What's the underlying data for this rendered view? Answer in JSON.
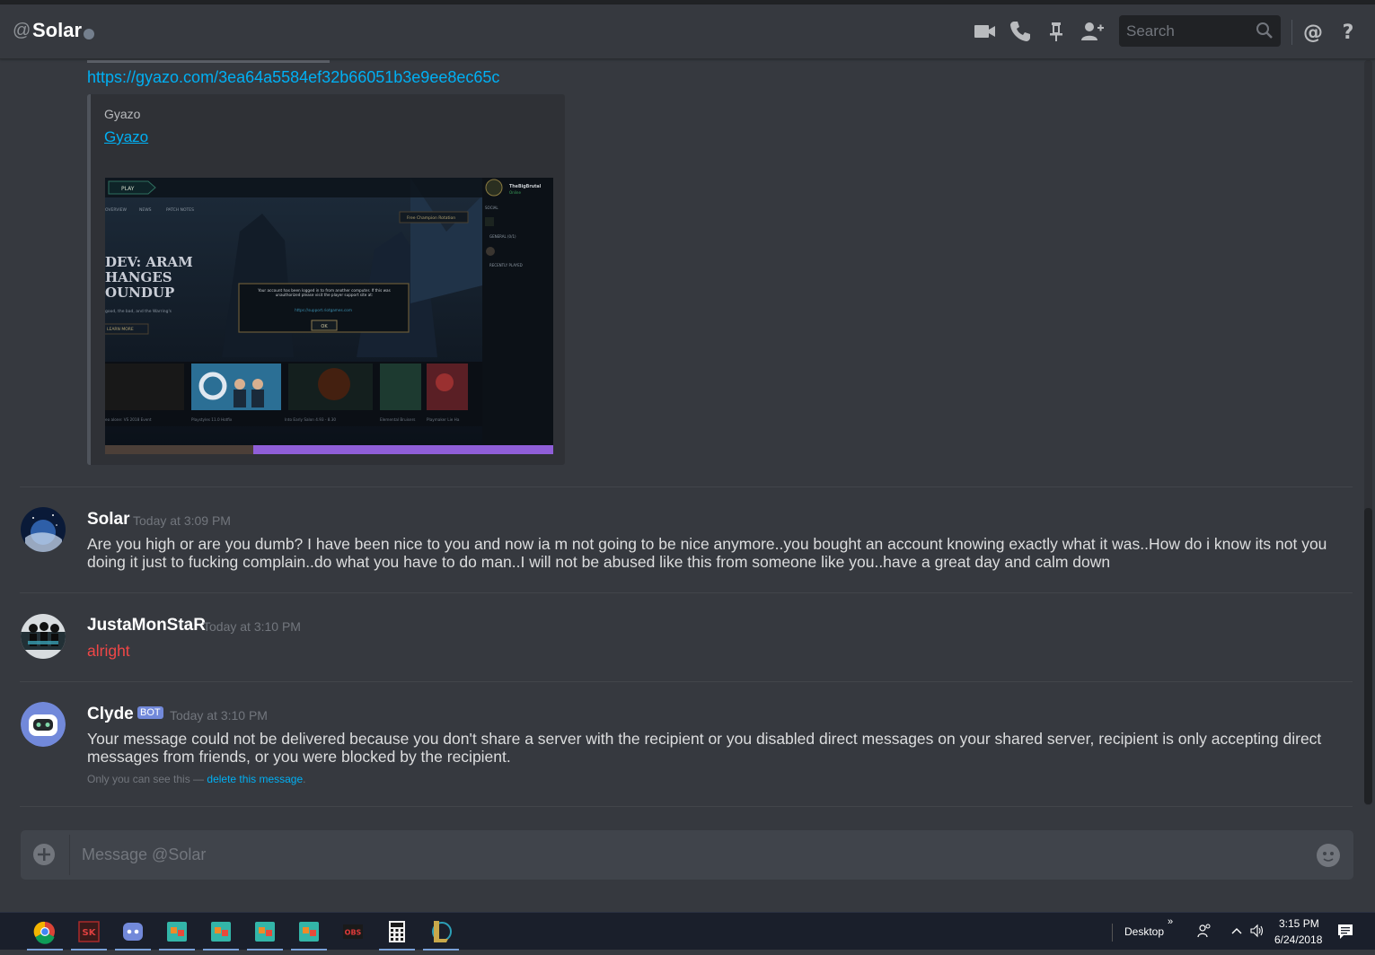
{
  "header": {
    "title": "Solar",
    "search_placeholder": "Search"
  },
  "embed": {
    "link": "https://gyazo.com/3ea64a5584ef32b66051b3e9ee8ec65c",
    "provider": "Gyazo",
    "title": "Gyazo",
    "screenshot": {
      "play_label": "PLAY",
      "nav": [
        "OVERVIEW",
        "NEWS",
        "PATCH NOTES"
      ],
      "headline": [
        "DEV: ARAM",
        "HANGES",
        "OUNDUP"
      ],
      "sub": "good, the bad, and the Warring's",
      "learn_more": "LEARN MORE",
      "rotation_btn": "Free Champion Rotation",
      "dialog_text": "Your account has been logged in to from another computer. If this was unauthorized please visit the player support site at:",
      "dialog_link": "https://support.riotgames.com",
      "dialog_ok": "OK",
      "social_name": "TheBigBrutal",
      "social_status": "Online",
      "social_header": "SOCIAL",
      "social_group1": "GENERAL (0/1)",
      "social_group2": "RECENTLY PLAYED",
      "tiles": [
        "eo alone: VS 2018 Event",
        "Playstyles 11.0 Hotfix",
        "Into Early Salon 4.93 - 8.30",
        "Elemental Bruisers",
        "Playmaker Lie Ha"
      ]
    }
  },
  "messages": [
    {
      "username": "Solar",
      "timestamp": "Today at 3:09 PM",
      "text": "Are you high or are you dumb? I have been nice to you and now ia m not going to be nice anymore..you bought an account knowing exactly what it was..How do i  know its not you doing it just to fucking complain..do what you have to do man..I will not be abused like this from someone like you..have a great day and calm down"
    },
    {
      "username": "JustaMonStaR",
      "timestamp": "Today at 3:10 PM",
      "text": "alright"
    },
    {
      "username": "Clyde",
      "bot_tag": "BOT",
      "timestamp": "Today at 3:10 PM",
      "text": "Your message could not be delivered because you don't share a server with the recipient or you disabled direct messages on your shared server, recipient is only accepting direct messages from friends, or you were blocked by the recipient.",
      "note_prefix": "Only you can see this — ",
      "note_link": "delete this message",
      "note_suffix": "."
    }
  ],
  "composer": {
    "placeholder": "Message @Solar"
  },
  "taskbar": {
    "desktop_label": "Desktop",
    "time": "3:15 PM",
    "date": "6/24/2018",
    "obs_label": "OBS"
  },
  "colors": {
    "background": "#36393f",
    "link": "#00b0f4",
    "bot_badge": "#7289da",
    "alright_text": "#f04747"
  }
}
